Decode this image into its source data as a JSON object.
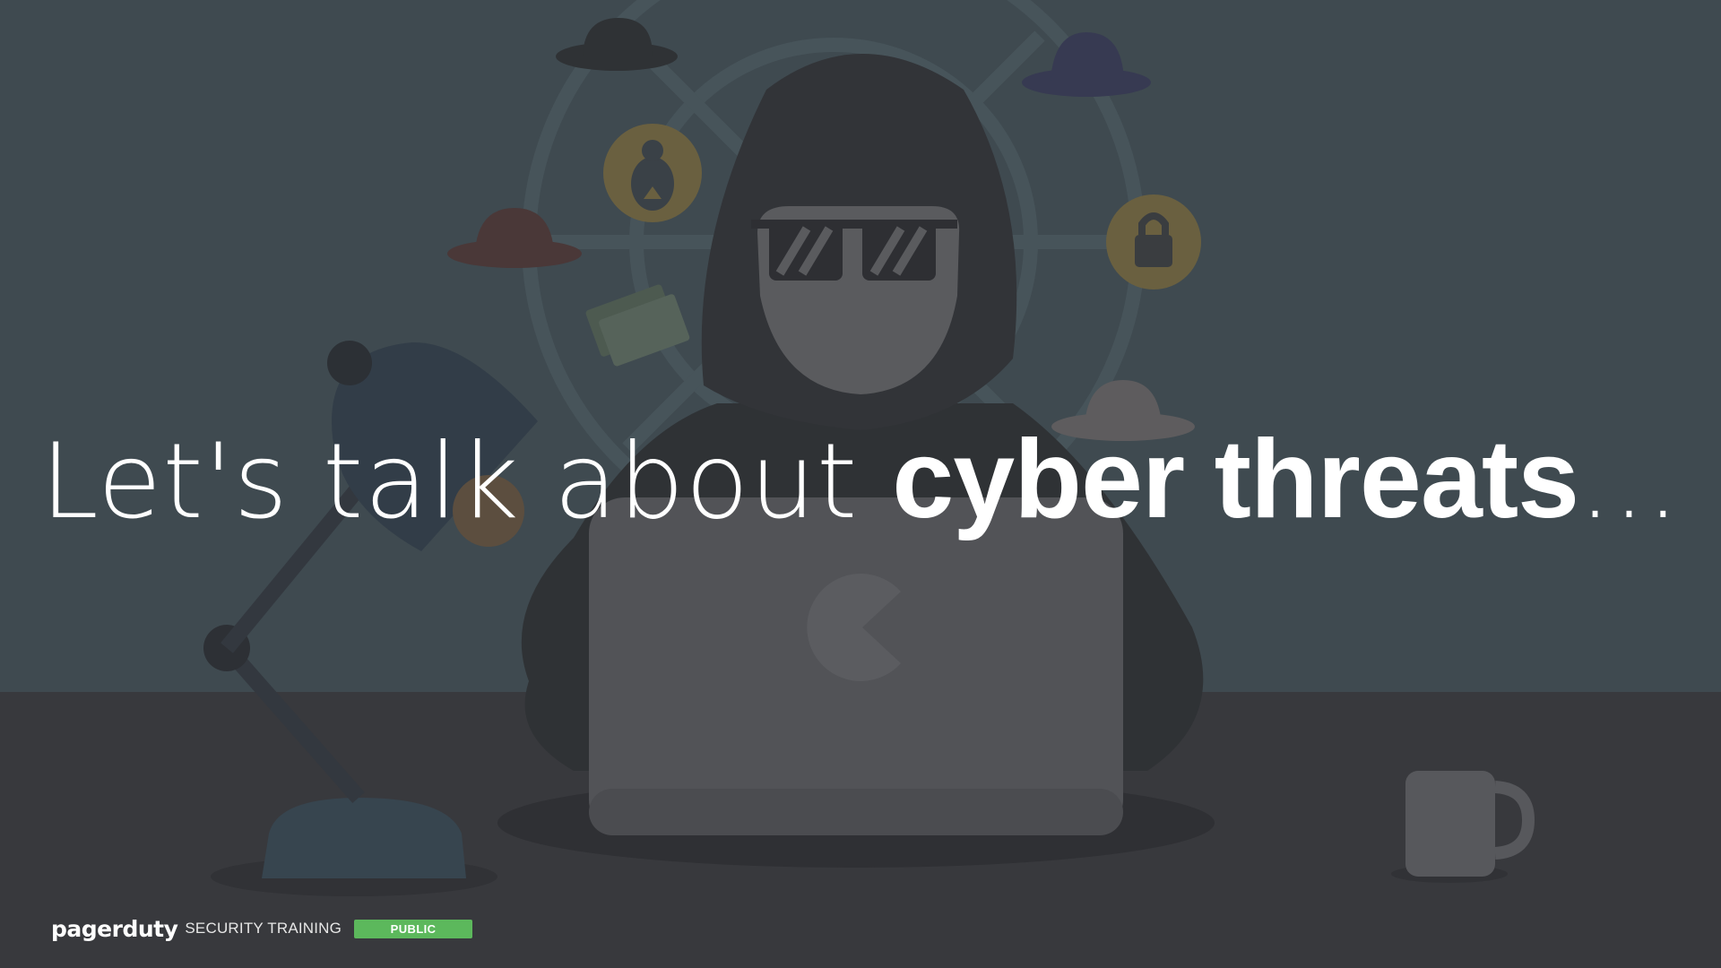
{
  "headline": {
    "light": "Let's talk about ",
    "bold": "cyber threats",
    "ellipsis": "..."
  },
  "footer": {
    "brand": "pagerduty",
    "label": "SECURITY TRAINING",
    "badge": "PUBLIC"
  },
  "colors": {
    "wall": "#3f4a50",
    "desk": "#38393d",
    "badge": "#5cb85c",
    "text": "#ffffff"
  },
  "icons": [
    "hat-icon",
    "bug-icon",
    "lock-icon",
    "money-icon",
    "hooded-hacker",
    "laptop",
    "desk-lamp",
    "coffee-mug"
  ]
}
